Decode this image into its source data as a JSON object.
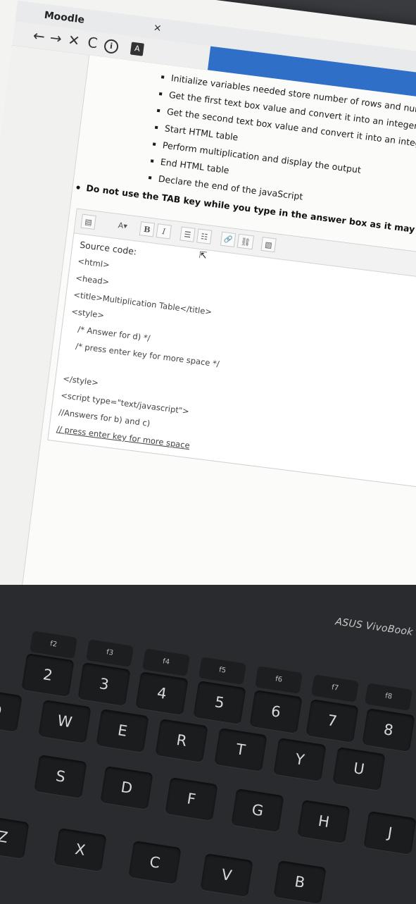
{
  "browser": {
    "app_title": "Moodle",
    "nav_back": "←",
    "nav_forward": "→",
    "nav_stop": "✕",
    "nav_reload": "C",
    "info_icon": "i",
    "pdf_icon": "A",
    "close": "×"
  },
  "instructions": {
    "sub_bullets": [
      "Initialize variables needed store number of rows and num",
      "Get the first text box value and convert it into an integer",
      "Get the second text box value and convert it into an integer",
      "Start HTML table",
      "Perform multiplication and display the output",
      "End HTML table",
      "Declare the end of the javaScript"
    ],
    "main_bullet": "Do not use the TAB key while you type in the answer box as it may go to the n"
  },
  "editor": {
    "toolbar": {
      "paragraph_icon": "▤",
      "font_size": "A",
      "dropdown": "▾",
      "bold": "B",
      "italic": "I",
      "unordered_list": "☰",
      "ordered_list": "☷",
      "link": "🔗",
      "unlink": "⛓",
      "image": "▨"
    },
    "lines": [
      "Source code:",
      "<html>",
      "<head>",
      "<title>Multiplication Table</title>",
      "<style>",
      "/* Answer for d) */",
      "/* press enter key for more space  */",
      "",
      "</style>",
      "<script type=\"text/javascript\">",
      "//Answers for b) and c)",
      "// press enter key for more space"
    ]
  },
  "laptop": {
    "brand": "ASUS VivoBook",
    "fkeys": [
      "f2",
      "f3",
      "f4",
      "f5",
      "f6",
      "f7",
      "f8"
    ],
    "row_numbers": [
      "2",
      "3",
      "4",
      "5",
      "6",
      "7",
      "8"
    ],
    "row_top": [
      "W",
      "E",
      "R",
      "T",
      "Y",
      "U"
    ],
    "row_home": [
      "S",
      "D",
      "F",
      "G",
      "H",
      "J"
    ],
    "row_bottom": [
      "Z",
      "X",
      "C",
      "V",
      "B"
    ],
    "edge_left_top": "Q"
  }
}
